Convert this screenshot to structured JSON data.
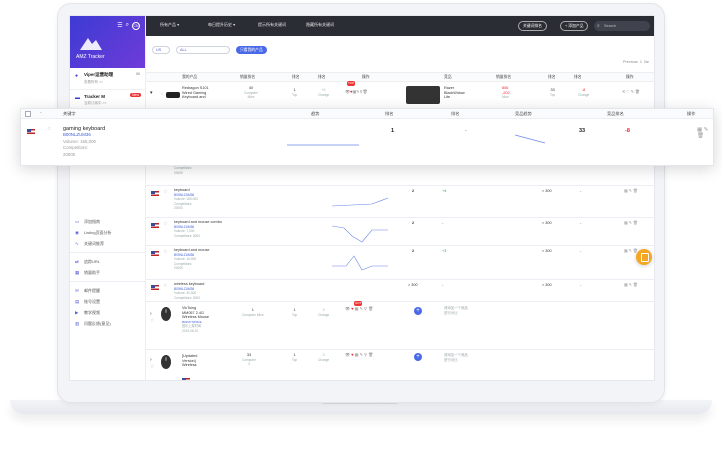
{
  "sidebar": {
    "brand": "AMZ Tracker",
    "brand_icons": [
      "☰",
      "⌕",
      "CN"
    ],
    "accounts": [
      {
        "title": "Viper运营助理",
        "sub": "查看所有 >>",
        "right": "88"
      },
      {
        "title": "Tracker M",
        "sub": "当前订阅中 >>",
        "badge": "New"
      }
    ],
    "nav": [
      {
        "label": "添加指南",
        "icon": "▭"
      },
      {
        "label": "Listing页面分析",
        "icon": "◉"
      },
      {
        "label": "关键词推荐",
        "icon": "∿"
      },
      {
        "label": "追踪URL",
        "icon": "⇄"
      },
      {
        "label": "销量助手",
        "icon": "▦"
      },
      {
        "label": "邮件提醒",
        "icon": "✉"
      },
      {
        "label": "账号设置",
        "icon": "▤"
      },
      {
        "label": "教学视频",
        "icon": "▶"
      },
      {
        "label": "问题反馈(意见)",
        "icon": "▥"
      }
    ]
  },
  "topbar": {
    "menus": [
      "所有产品 ▾",
      "每日提升历史 ▾",
      "提示所有关键词",
      "隐藏所有关键词"
    ],
    "buttons": [
      "关键词排名",
      "+ 添加产品"
    ],
    "search_placeholder": "Search"
  },
  "filters": {
    "select1": "US",
    "select2": "ALL",
    "action": "只看我的产品",
    "pager": [
      "Previous",
      "1",
      "Ne"
    ]
  },
  "product_header": [
    "我的产品",
    "销量排名",
    "排名",
    "排名",
    "操作",
    "竞品",
    "销量排名",
    "排名",
    "排名",
    "操作"
  ],
  "product_top": {
    "name": [
      "Redragon S101",
      "Wired Gaming",
      "Keyboard and"
    ],
    "sales_rank": "40",
    "sales_sub": [
      "Computer",
      "Mice"
    ],
    "rank1": "1",
    "rank1_sub": "Top",
    "rank2": "+0",
    "rank2_sub": "Change",
    "comp_name": [
      "Razer",
      "BlackWidow",
      "Lite"
    ],
    "comp_rank": "806",
    "comp_change": "-202",
    "comp_sub": "Mice",
    "comp_r1": "33",
    "comp_r1_sub": "Top",
    "comp_r2": "-8",
    "comp_r2_sub": "Change",
    "hot_badge": "TOP"
  },
  "card": {
    "headers": [
      "关键字",
      "趋势",
      "排名",
      "排名",
      "竞品趋势",
      "竞品排名",
      "操作"
    ],
    "keyword": "gaming keyboard",
    "asin": "B00NLZUM36",
    "volume": "Volume: 165,000",
    "competitors": "Competitors:",
    "competitors_count": "20000",
    "rank": "1",
    "change": "-",
    "comp_rank": "33",
    "comp_change": "-8"
  },
  "keyword_rows": [
    {
      "keyword": "",
      "asin": "",
      "volume": "",
      "competitors": "Competitors:",
      "count": "20000",
      "rank": "",
      "change": "",
      "comp_rank": "",
      "comp_change": ""
    },
    {
      "keyword": "keyboard",
      "asin": "B00NLZUM36",
      "volume": "Volume: 165,000",
      "competitors": "Competitors:",
      "count": "20000",
      "rank": "2",
      "change": "+4",
      "comp_rank": "> 300",
      "comp_change": "-"
    },
    {
      "keyword": "keyboard and mouse combo",
      "asin": "B00NLZUM36",
      "volume": "Volume: 7,000",
      "competitors": "Competitors: 8000",
      "count": "",
      "rank": "2",
      "change": "-",
      "comp_rank": "> 300",
      "comp_change": "-"
    },
    {
      "keyword": "keyboard and mouse",
      "asin": "B00NLZUM36",
      "volume": "Volume: 16,500",
      "competitors": "Competitors:",
      "count": "20000",
      "rank": "2",
      "change": "+3",
      "comp_rank": "> 300",
      "comp_change": "-"
    },
    {
      "keyword": "wireless keyboard",
      "asin": "B00NLZUM36",
      "volume": "Volume: 30,500",
      "competitors": "Competitors: 8000",
      "count": "",
      "rank": "> 300",
      "change": "-",
      "comp_rank": "> 300",
      "comp_change": "-"
    }
  ],
  "products_bottom": [
    {
      "name": [
        "VicTsing",
        "MM057 2.4G",
        "Wireless Mouse"
      ],
      "asin": "B01MYSP0CE",
      "meta": "提示上架时间",
      "date": "2015-08-10",
      "sales": "1",
      "sales_sub": "Computer Mice",
      "rank1": "1",
      "rank1_sub": "Top",
      "rank2": "0",
      "rank2_sub": "Change",
      "comp": [
        "请添加一个竞品",
        "进行对比"
      ],
      "hot_badge": "HOT"
    },
    {
      "name": [
        "[Updated",
        "Version]",
        "Wireless"
      ],
      "asin": "",
      "meta": "",
      "date": "",
      "sales": "33",
      "sales_sub": "Computer",
      "sales_sub2": "4",
      "rank1": "1",
      "rank1_sub": "Top",
      "rank2": "0",
      "rank2_sub": "Change",
      "comp": [
        "请添加一个竞品",
        "进行对比"
      ],
      "hot_badge": ""
    }
  ]
}
